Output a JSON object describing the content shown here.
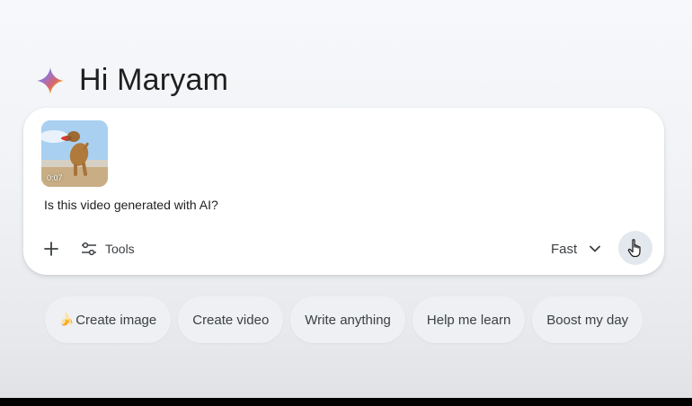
{
  "greeting": {
    "text": "Hi Maryam",
    "icon": "gemini-spark-icon"
  },
  "composer": {
    "attachment": {
      "type": "video",
      "duration": "0:07"
    },
    "prompt": "Is this video generated with AI?",
    "toolbar": {
      "add_icon": "plus-icon",
      "tools_label": "Tools",
      "tools_icon": "sliders-icon",
      "model_label": "Fast",
      "model_icon": "chevron-down-icon",
      "send_icon": "hand-cursor-icon"
    }
  },
  "suggestions": [
    {
      "emoji": "🍌",
      "label": "Create image"
    },
    {
      "emoji": "",
      "label": "Create video"
    },
    {
      "emoji": "",
      "label": "Write anything"
    },
    {
      "emoji": "",
      "label": "Help me learn"
    },
    {
      "emoji": "",
      "label": "Boost my day"
    }
  ],
  "colors": {
    "background": "#f1f3f6",
    "card": "#ffffff",
    "text": "#1f1f1f",
    "chip": "#eef0f3",
    "send_button": "#e3e7ee"
  }
}
